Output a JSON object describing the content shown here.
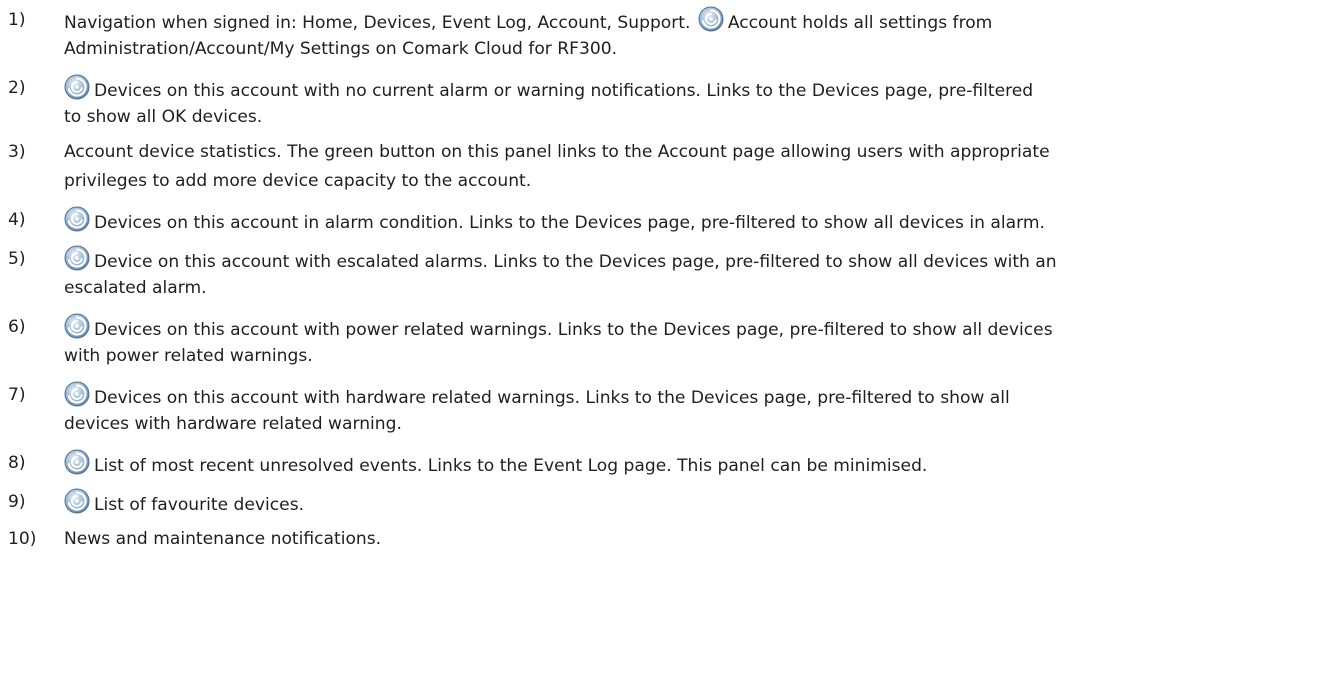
{
  "items": [
    {
      "number": "1)",
      "text_a": "Navigation when signed in: Home, Devices, Event Log, Account, Support.",
      "icon": "comark-swirl-logo-icon",
      "text_b": "Account holds all settings from",
      "line2": "Administration/Account/My Settings on Comark Cloud for RF300."
    },
    {
      "number": "2)",
      "icon": "comark-swirl-logo-icon",
      "line1": "Devices on this account with no current alarm or warning notifications. Links to the Devices page, pre-filtered",
      "line2": "to show all OK devices."
    },
    {
      "number": "3)",
      "line1": "Account device statistics. The green button on this panel links to the Account page allowing users with appropriate",
      "line2": "privileges to add more device capacity to the account."
    },
    {
      "number": "4)",
      "icon": "comark-swirl-logo-icon",
      "line1": "Devices on this account in alarm condition. Links to the Devices page, pre-filtered to show all devices in alarm."
    },
    {
      "number": "5)",
      "icon": "comark-swirl-logo-icon",
      "line1": "Device on this account with escalated alarms. Links to the Devices page, pre-filtered to show all devices with an",
      "line2": "escalated alarm."
    },
    {
      "number": "6)",
      "icon": "comark-swirl-logo-icon",
      "line1": "Devices on this account with power related warnings. Links to the Devices page, pre-filtered to show all devices",
      "line2": "with power related warnings."
    },
    {
      "number": "7)",
      "icon": "comark-swirl-logo-icon",
      "line1": "Devices on this account with hardware related warnings. Links to the Devices page, pre-filtered to show all",
      "line2": "devices with hardware related warning."
    },
    {
      "number": "8)",
      "icon": "comark-swirl-logo-icon",
      "line1": "List of most recent unresolved events. Links to the Event Log page. This panel can be minimised."
    },
    {
      "number": "9)",
      "icon": "comark-swirl-logo-icon",
      "line1": "List of favourite devices."
    },
    {
      "number": "10)",
      "line1": "News and maintenance notifications."
    }
  ],
  "colors": {
    "text": "#1f1f1f",
    "icon_ring_outer": "#6f8fb0",
    "icon_ring_inner": "#9fbad3",
    "icon_swirl": "#ffffff"
  }
}
